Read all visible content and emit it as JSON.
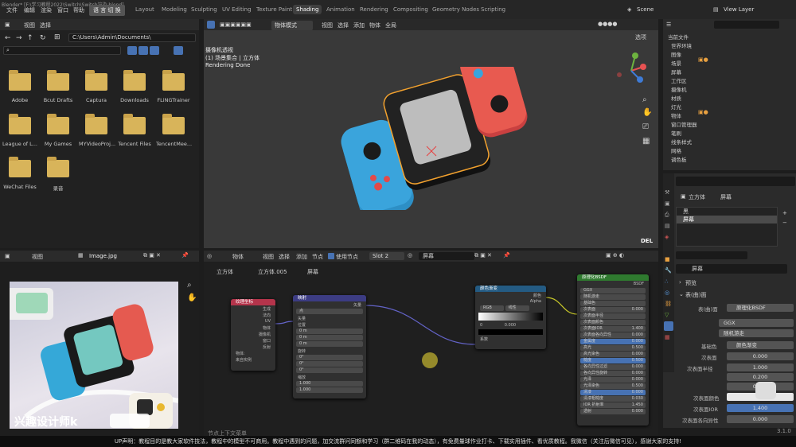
{
  "window_title": "Blender* [F:\\学习教程2022\\Switch\\Switch渲染.blend]",
  "menus": [
    "文件",
    "编辑",
    "渲染",
    "窗口",
    "帮助"
  ],
  "lang_button": "语 言 切 换",
  "workspaces": [
    "Layout",
    "Modeling",
    "Sculpting",
    "UV Editing",
    "Texture Paint",
    "Shading",
    "Animation",
    "Rendering",
    "Compositing",
    "Geometry Nodes",
    "Scripting"
  ],
  "active_workspace": "Shading",
  "scene": "Scene",
  "view_layer": "View Layer",
  "file_browser": {
    "menus": [
      "视图",
      "选择"
    ],
    "path": "C:\\Users\\Admin\\Documents\\",
    "folders": [
      "Adobe",
      "Bcut Drafts",
      "Captura",
      "Downloads",
      "FLiNGTrainer",
      "League of L...",
      "My Games",
      "MYVideoProj...",
      "Tencent Files",
      "TencentMee...",
      "WeChat Files",
      "录音"
    ]
  },
  "viewport": {
    "mode": "物体模式",
    "menus": [
      "视图",
      "选择",
      "添加",
      "物体"
    ],
    "transform": "全局",
    "options": "选项",
    "info_line1": "摄像机透视",
    "info_line2": "(1) 场景集合 | 立方体",
    "info_line3": "Rendering Done",
    "del_key": "DEL"
  },
  "outliner": {
    "header": "当前文件",
    "items": [
      "世界环境",
      "图像",
      "场景",
      "屏幕",
      "工作区",
      "摄像机",
      "材质",
      "灯光",
      "物体",
      "窗口管理器",
      "笔刷",
      "线条样式",
      "网格",
      "调色板"
    ]
  },
  "properties": {
    "breadcrumb_obj": "立方体",
    "breadcrumb_mat": "屏幕",
    "slots": [
      "黑",
      "屏幕"
    ],
    "material_name": "屏幕",
    "preview": "预览",
    "surface": "表(曲)面",
    "surface_label": "表(曲)面",
    "shader": "原理化BSDF",
    "dist": "GGX",
    "sss_method": "随机游走",
    "rows": [
      {
        "label": "基础色",
        "value": "颜色渐变"
      },
      {
        "label": "次表面",
        "value": "0.000"
      },
      {
        "label": "次表面半径",
        "value": "1.000"
      },
      {
        "label": "",
        "value": "0.200"
      },
      {
        "label": "",
        "value": "0.100"
      },
      {
        "label": "次表面颜色",
        "value": ""
      },
      {
        "label": "次表面IOR",
        "value": "1.400"
      },
      {
        "label": "次表面各向异性",
        "value": "0.000"
      }
    ]
  },
  "image_editor": {
    "menus": [
      "视图"
    ],
    "image_name": "Image.jpg"
  },
  "node_editor": {
    "object": "物体",
    "menus": [
      "视图",
      "选择",
      "添加",
      "节点"
    ],
    "use_nodes": "使用节点",
    "slot": "Slot 2",
    "material": "屏幕",
    "breadcrumb": [
      "立方体",
      "立方体.005",
      "屏幕"
    ],
    "nodes": {
      "texcoord": {
        "title": "纹理坐标",
        "outs": [
          "生成",
          "法向",
          "UV",
          "物体",
          "摄像机",
          "窗口",
          "反射"
        ],
        "obj": "物体:",
        "inst": "来自实例"
      },
      "mapping": {
        "title": "映射",
        "type_label": "类型:",
        "type": "点",
        "out": "矢量",
        "vec": "矢量",
        "pos": "位置",
        "rot": "旋转",
        "scale": "缩放",
        "axes": [
          "X",
          "Y",
          "Z"
        ],
        "pos_vals": [
          "0 m",
          "0 m",
          "0 m"
        ],
        "rot_vals": [
          "0°",
          "0°",
          "0°"
        ],
        "scale_vals": [
          "1.000",
          "1.000",
          "1.000"
        ]
      },
      "ramp": {
        "title": "颜色渐变",
        "outs": [
          "颜色",
          "Alpha"
        ],
        "mode": "RGB",
        "interp": "线性",
        "idx": "0",
        "pos": "0.000",
        "fac": "系数"
      },
      "bsdf": {
        "title": "原理化BSDF",
        "out": "BSDF",
        "dist": "GGX",
        "sss": "随机游走",
        "rows": [
          "基础色",
          "次表面",
          "次表面半径",
          "次表面颜色",
          "次表面IOR",
          "次表面各向异性",
          "金属度",
          "高光",
          "高光染色",
          "糙度",
          "各向异性过滤",
          "各向异性旋转",
          "光泽",
          "光泽染色",
          "清漆",
          "清漆粗糙度",
          "IOR 折射率",
          "透射"
        ],
        "vals": [
          "",
          "0.000",
          "",
          "",
          "1.400",
          "0.000",
          "0.000",
          "0.500",
          "0.000",
          "0.500",
          "0.000",
          "0.000",
          "0.000",
          "0.500",
          "0.000",
          "0.030",
          "1.450",
          "0.000"
        ]
      }
    },
    "status": "节点上下文菜单"
  },
  "watermark": "兴趣设计师k",
  "version": "3.1.0",
  "subtitle": "UP声明：教程目的是教大家软件技法，教程中的模型不可商用。教程中遇到的问题，加交流群问同额和学习（群二维码在我的动态），有免费量球作业打卡、下载实用插件、看优质教程。我微信（关注后微信可见），感谢大家的支持!"
}
